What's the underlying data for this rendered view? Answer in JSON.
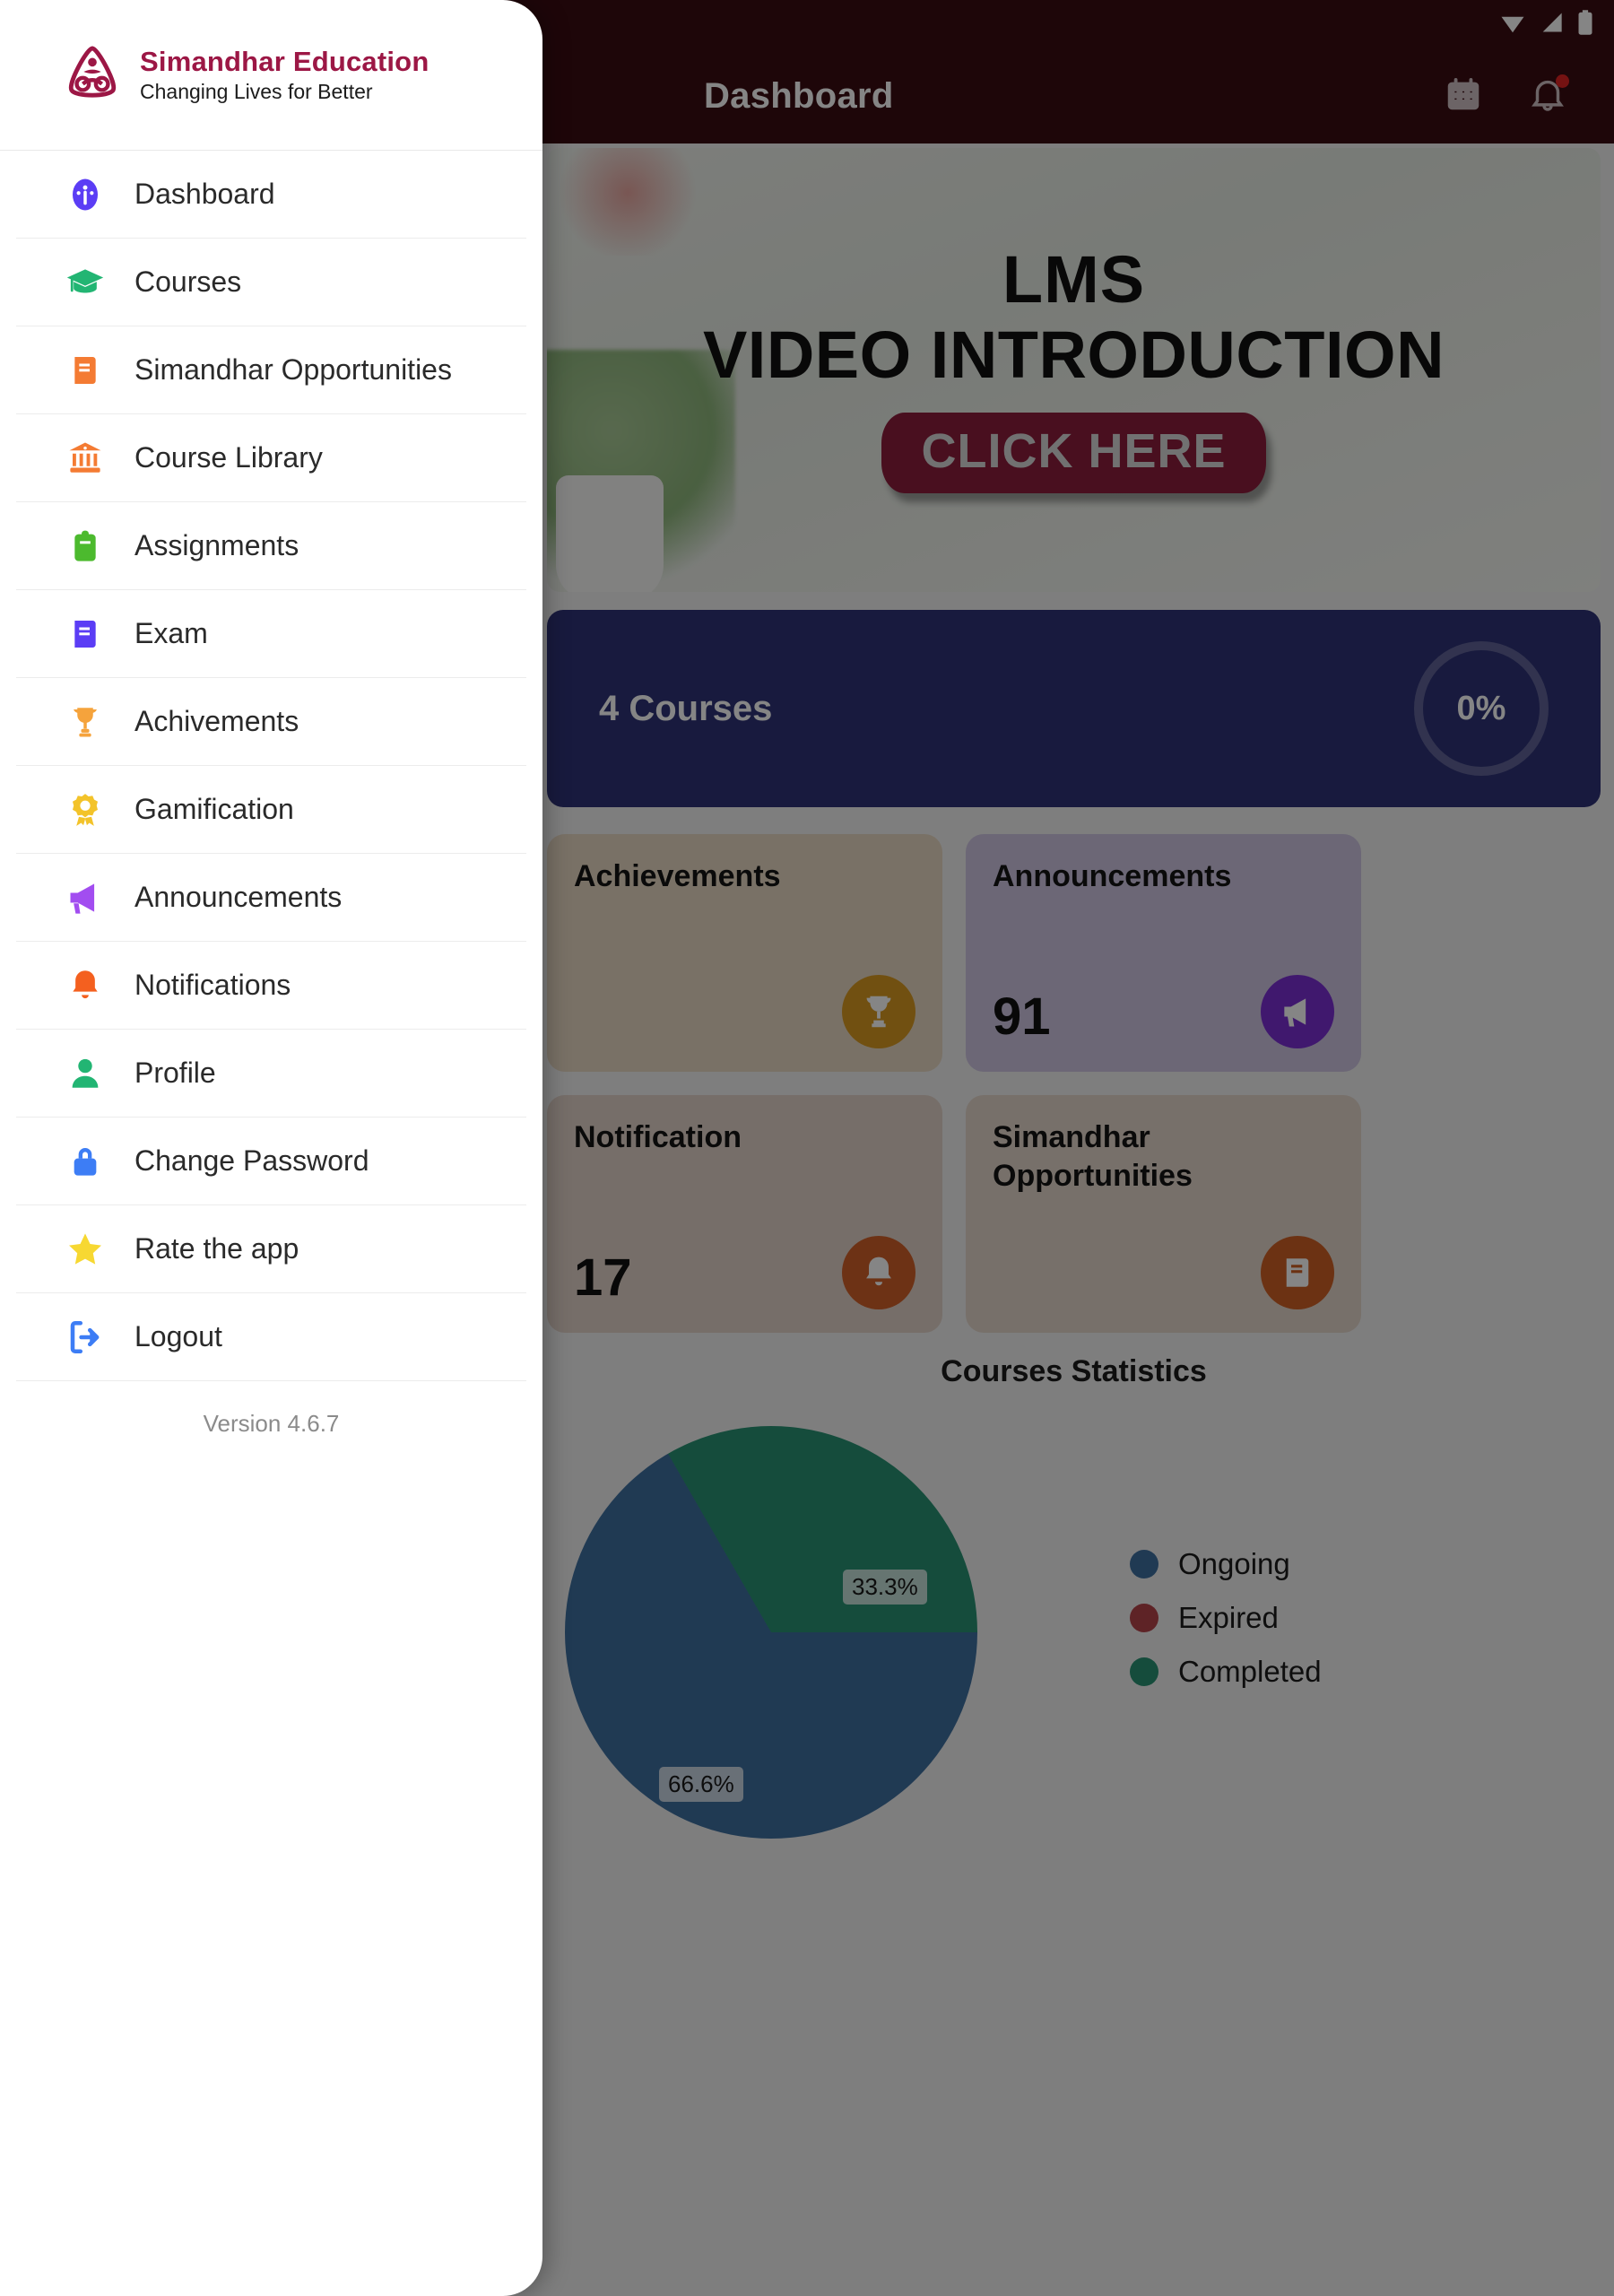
{
  "statusbar": {
    "icons": [
      "wifi-icon",
      "cellular-signal-icon",
      "battery-icon"
    ]
  },
  "appbar": {
    "title": "Dashboard",
    "calendar_icon": "calendar-icon",
    "notification_icon": "bell-icon",
    "badge_visible": true,
    "background": "#3b0d13"
  },
  "banner": {
    "line1": "LMS",
    "line2": "VIDEO INTRODUCTION",
    "cta_label": "CLICK HERE",
    "cta_color": "#8c1d3c"
  },
  "progress": {
    "courses_label": "4 Courses",
    "percent_label": "0%",
    "card_color": "#2e3377"
  },
  "stats": [
    {
      "title": "Achievements",
      "value": "",
      "icon": "trophy-icon",
      "card_color": "#e9d9c3",
      "icon_color": "#d99a22"
    },
    {
      "title": "Announcements",
      "value": "91",
      "icon": "megaphone-icon",
      "card_color": "#cfc6e2",
      "icon_color": "#7b2fd4"
    },
    {
      "title": "Notification",
      "value": "17",
      "icon": "bell-icon",
      "card_color": "#e3d3c9",
      "icon_color": "#d1612a"
    },
    {
      "title": "Simandhar Opportunities",
      "value": "",
      "icon": "book-icon",
      "card_color": "#e4d6cc",
      "icon_color": "#cf6125"
    }
  ],
  "chart_data": {
    "type": "pie",
    "title": "Courses Statistics",
    "categories": [
      "Ongoing",
      "Expired",
      "Completed"
    ],
    "values": [
      66.6,
      0,
      33.3
    ],
    "data_labels": [
      "66.6%",
      "33.3%"
    ],
    "colors": [
      "#3f6fa0",
      "#b4434a",
      "#2a9273"
    ],
    "legend_position": "right",
    "legend": [
      {
        "label": "Ongoing",
        "color": "#3f6fa0"
      },
      {
        "label": "Expired",
        "color": "#b4434a"
      },
      {
        "label": "Completed",
        "color": "#2a9273"
      }
    ]
  },
  "drawer": {
    "brand_name": "Simandhar Education",
    "brand_tagline": "Changing Lives for Better",
    "version": "Version 4.6.7",
    "items": [
      {
        "label": "Dashboard",
        "icon": "gauge-icon",
        "color": "#5b3df5"
      },
      {
        "label": "Courses",
        "icon": "graduation-cap-icon",
        "color": "#22b573"
      },
      {
        "label": "Simandhar Opportunities",
        "icon": "book-icon",
        "color": "#f47b33"
      },
      {
        "label": "Course Library",
        "icon": "bank-icon",
        "color": "#f47b33"
      },
      {
        "label": "Assignments",
        "icon": "clipboard-icon",
        "color": "#4cba2e"
      },
      {
        "label": "Exam",
        "icon": "book-icon",
        "color": "#5b3df5"
      },
      {
        "label": "Achivements",
        "icon": "trophy-icon",
        "color": "#f5a33c"
      },
      {
        "label": "Gamification",
        "icon": "medal-icon",
        "color": "#f3c32a"
      },
      {
        "label": "Announcements",
        "icon": "megaphone-icon",
        "color": "#a24df0"
      },
      {
        "label": "Notifications",
        "icon": "bell-icon",
        "color": "#f4601f"
      },
      {
        "label": "Profile",
        "icon": "person-icon",
        "color": "#22b573"
      },
      {
        "label": "Change Password",
        "icon": "lock-icon",
        "color": "#3d7df5"
      },
      {
        "label": "Rate the app",
        "icon": "star-icon",
        "color": "#f7d832"
      },
      {
        "label": "Logout",
        "icon": "logout-icon",
        "color": "#3d7df5"
      }
    ]
  }
}
